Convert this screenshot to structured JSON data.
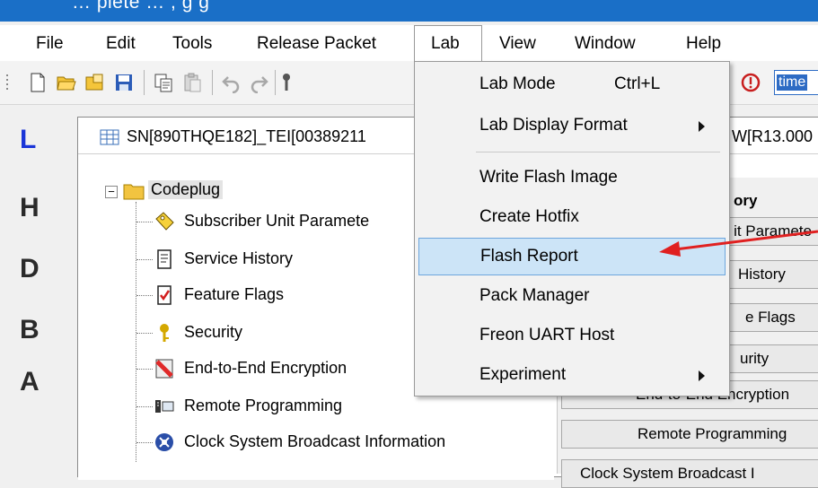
{
  "titlebar": {
    "partial_text": "…  plete …   , g     g"
  },
  "menu": {
    "items": [
      "File",
      "Edit",
      "Tools",
      "Release Packet",
      "Lab",
      "View",
      "Window",
      "Help"
    ]
  },
  "toolbar": {
    "field_value": "time"
  },
  "leftbar": {
    "letters": [
      "L",
      "H",
      "D",
      "B",
      "A"
    ]
  },
  "window": {
    "title_left": "SN[890THQE182]_TEI[00389211",
    "title_right": "W[R13.000"
  },
  "tree": {
    "root": "Codeplug",
    "root_expander": "−",
    "items": [
      "Subscriber Unit Paramete",
      "Service History",
      "Feature Flags",
      "Security",
      "End-to-End Encryption",
      "Remote Programming",
      "Clock System Broadcast Information"
    ]
  },
  "right_panel": {
    "header": "ory",
    "buttons": [
      "it Paramete",
      "History",
      "e Flags",
      "urity",
      "End-to-End Encryption",
      "Remote Programming",
      "Clock System Broadcast I"
    ]
  },
  "lab_menu": {
    "items": [
      {
        "label": "Lab Mode",
        "shortcut": "Ctrl+L"
      },
      {
        "label": "Lab Display Format",
        "submenu": true
      },
      {
        "label": "Write Flash Image"
      },
      {
        "label": "Create Hotfix"
      },
      {
        "label": "Flash Report",
        "highlighted": true
      },
      {
        "label": "Pack Manager"
      },
      {
        "label": "Freon UART Host"
      },
      {
        "label": "Experiment",
        "submenu": true
      }
    ]
  },
  "colors": {
    "titlebar": "#1a6fc7",
    "highlight": "#cce4f7",
    "highlight_border": "#6ea6dd",
    "arrow": "#e02020",
    "letter_L": "#1a35d8"
  }
}
